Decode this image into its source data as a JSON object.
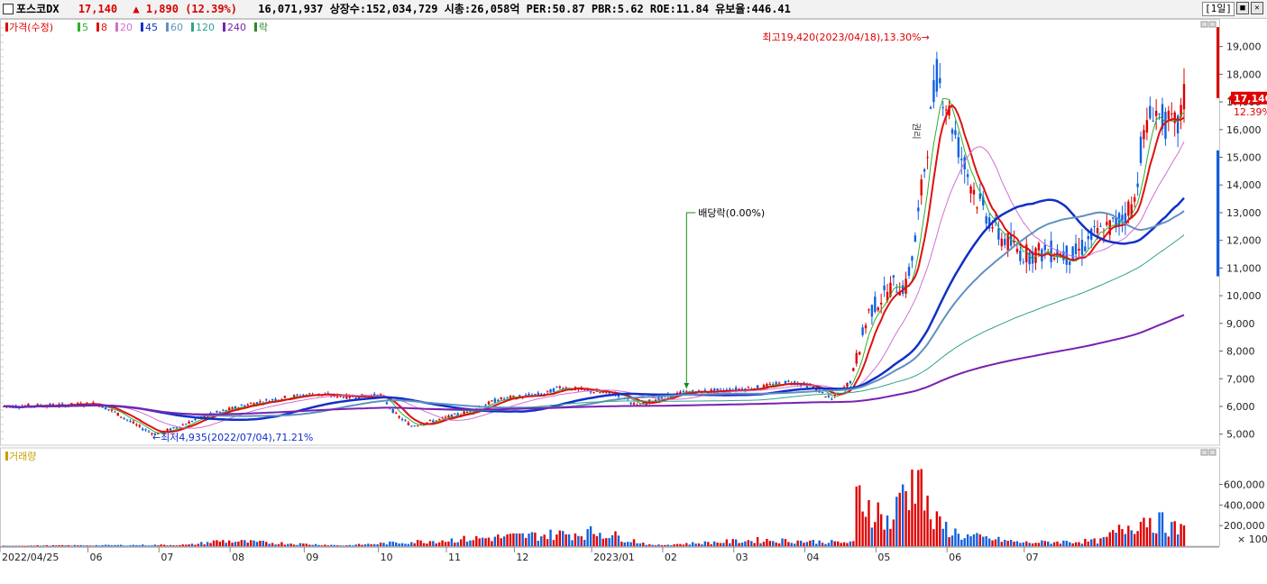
{
  "header": {
    "name": "포스코DX",
    "price": "17,140",
    "change": "▲ 1,890 (12.39%)",
    "stats": "16,071,937 상장수:152,034,729 시총:26,058억 PER:50.87 PBR:5.62 ROE:11.84 유보율:446.41",
    "period": "[1일]"
  },
  "legend": {
    "price_label": "가격(수정)",
    "items": [
      {
        "label": "5",
        "color": "#2db02d"
      },
      {
        "label": "8",
        "color": "#e01010"
      },
      {
        "label": "20",
        "color": "#d070d0"
      },
      {
        "label": "45",
        "color": "#1030c8"
      },
      {
        "label": "60",
        "color": "#6090c0"
      },
      {
        "label": "120",
        "color": "#30a090"
      },
      {
        "label": "240",
        "color": "#7a20b0"
      }
    ],
    "rak_label": "락",
    "volume_label": "거래량"
  },
  "annotations": {
    "high": "최고19,420(2023/04/18),13.30%→",
    "low": "←최저4,935(2022/07/04),71.21%",
    "dividend": "배당락(0.00%)",
    "rights": "권리",
    "last_price": "17,140",
    "last_pct": "12.39%",
    "volume_unit": "× 100"
  },
  "chart_data": {
    "type": "candlestick",
    "price_axis": {
      "ticks": [
        "5,000",
        "6,000",
        "7,000",
        "8,000",
        "9,000",
        "10,000",
        "11,000",
        "12,000",
        "13,000",
        "14,000",
        "15,000",
        "16,000",
        "17,000",
        "18,000",
        "19,000"
      ],
      "ylim": [
        4600,
        19900
      ]
    },
    "volume_axis": {
      "ticks": [
        "200,000",
        "400,000",
        "600,000"
      ],
      "ylim": [
        0,
        780000
      ]
    },
    "x_axis": {
      "labels": [
        "2022/04/25",
        "06",
        "07",
        "08",
        "09",
        "10",
        "11",
        "12",
        "2023/01",
        "02",
        "03",
        "04",
        "05",
        "06",
        "07"
      ]
    },
    "price_path": [
      [
        0,
        6000
      ],
      [
        20,
        6050
      ],
      [
        30,
        6100
      ],
      [
        35,
        5850
      ],
      [
        45,
        5200
      ],
      [
        49,
        5000
      ],
      [
        55,
        5200
      ],
      [
        65,
        5650
      ],
      [
        80,
        6100
      ],
      [
        90,
        6300
      ],
      [
        100,
        6450
      ],
      [
        112,
        6350
      ],
      [
        122,
        6400
      ],
      [
        127,
        5700
      ],
      [
        132,
        5300
      ],
      [
        140,
        5500
      ],
      [
        150,
        5800
      ],
      [
        160,
        6250
      ],
      [
        170,
        6400
      ],
      [
        175,
        6450
      ],
      [
        180,
        6700
      ],
      [
        190,
        6550
      ],
      [
        200,
        6400
      ],
      [
        205,
        6000
      ],
      [
        212,
        6300
      ],
      [
        220,
        6500
      ],
      [
        235,
        6600
      ],
      [
        245,
        6700
      ],
      [
        255,
        6900
      ],
      [
        262,
        6700
      ],
      [
        268,
        6250
      ],
      [
        274,
        6900
      ],
      [
        280,
        9400
      ],
      [
        288,
        10400
      ],
      [
        292,
        10300
      ],
      [
        295,
        12000
      ],
      [
        300,
        16400
      ],
      [
        302,
        18000
      ],
      [
        305,
        17000
      ],
      [
        310,
        15000
      ],
      [
        315,
        13500
      ],
      [
        322,
        12200
      ],
      [
        330,
        11500
      ],
      [
        340,
        11600
      ],
      [
        346,
        11400
      ],
      [
        352,
        12100
      ],
      [
        360,
        12600
      ],
      [
        366,
        13400
      ],
      [
        368,
        15300
      ],
      [
        372,
        16800
      ],
      [
        376,
        16200
      ],
      [
        380,
        16100
      ],
      [
        382,
        17140
      ]
    ],
    "candle_count": 383,
    "high": {
      "price": 19420,
      "date": "2023/04/18"
    },
    "low": {
      "price": 4935,
      "date": "2022/07/04"
    },
    "last": {
      "price": 17140,
      "change": 1890,
      "change_pct": 12.39
    },
    "moving_averages": [
      5,
      8,
      20,
      45,
      60,
      120,
      240
    ],
    "volume_pattern": [
      [
        0,
        5000
      ],
      [
        60,
        15000
      ],
      [
        70,
        60000
      ],
      [
        110,
        8000
      ],
      [
        193,
        160000
      ],
      [
        210,
        10000
      ],
      [
        245,
        70000
      ],
      [
        275,
        40000
      ],
      [
        276,
        580000
      ],
      [
        281,
        450000
      ],
      [
        287,
        250000
      ],
      [
        291,
        590000
      ],
      [
        296,
        760000
      ],
      [
        300,
        300000
      ],
      [
        310,
        120000
      ],
      [
        330,
        40000
      ],
      [
        355,
        60000
      ],
      [
        365,
        250000
      ],
      [
        370,
        330000
      ],
      [
        380,
        180000
      ]
    ]
  }
}
